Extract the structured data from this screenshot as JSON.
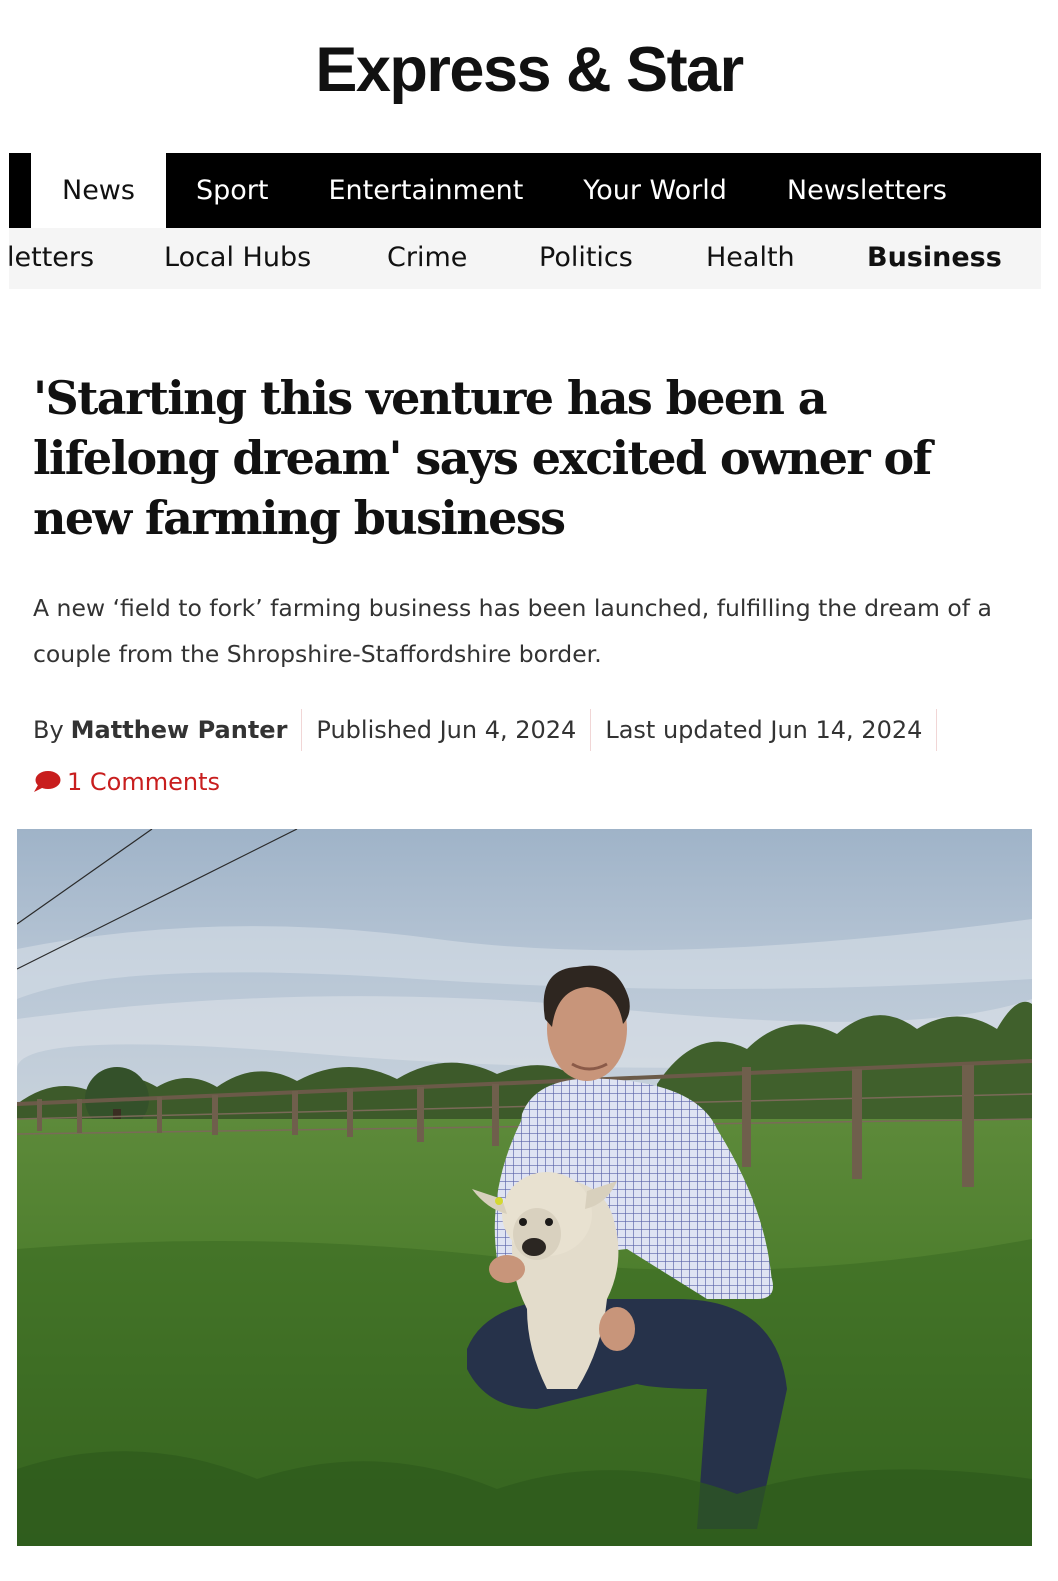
{
  "site": {
    "name": "Express & Star"
  },
  "primary_nav": [
    {
      "label": "News",
      "active": true
    },
    {
      "label": "Sport",
      "active": false
    },
    {
      "label": "Entertainment",
      "active": false
    },
    {
      "label": "Your World",
      "active": false
    },
    {
      "label": "Newsletters",
      "active": false
    }
  ],
  "secondary_nav": [
    {
      "label": "letters",
      "current": false
    },
    {
      "label": "Local Hubs",
      "current": false
    },
    {
      "label": "Crime",
      "current": false
    },
    {
      "label": "Politics",
      "current": false
    },
    {
      "label": "Health",
      "current": false
    },
    {
      "label": "Business",
      "current": true
    }
  ],
  "article": {
    "headline": "'Starting this venture has been a lifelong dream' says excited owner of new farming business",
    "standfirst": "A new ‘field to fork’ farming business has been launched, fulfilling the dream of a couple from the Shropshire-Staffordshire border.",
    "byline_prefix": "By",
    "author": "Matthew Panter",
    "published": "Published Jun 4, 2024",
    "updated": "Last updated Jun 14, 2024",
    "comments": "1 Comments",
    "comment_icon": "speech-bubble-icon",
    "accent_color": "#c81e1e"
  }
}
